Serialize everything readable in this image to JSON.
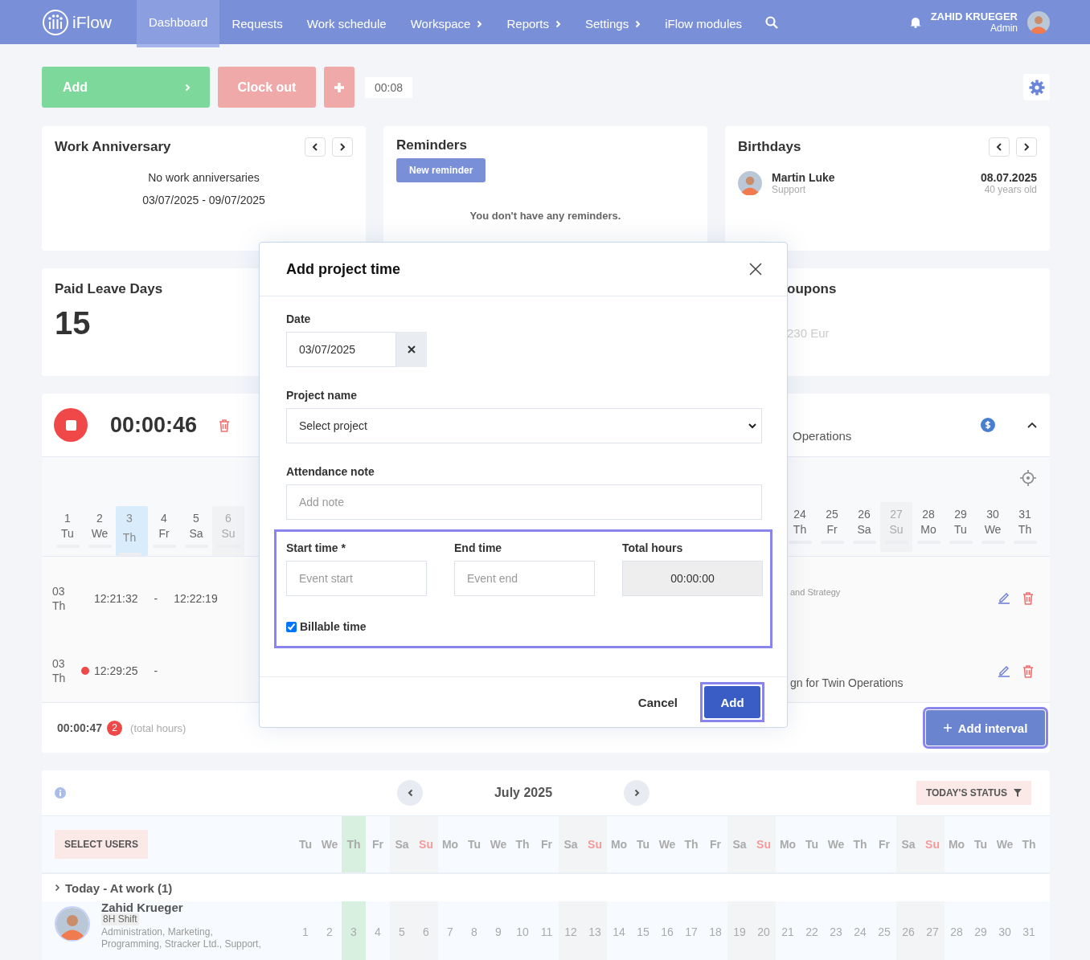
{
  "nav": {
    "logo": "iFlow",
    "items": [
      {
        "label": "Dashboard",
        "selected": true,
        "submenu": false
      },
      {
        "label": "Requests",
        "selected": false,
        "submenu": false
      },
      {
        "label": "Work schedule",
        "selected": false,
        "submenu": false
      },
      {
        "label": "Workspace",
        "selected": false,
        "submenu": true
      },
      {
        "label": "Reports",
        "selected": false,
        "submenu": true
      },
      {
        "label": "Settings",
        "selected": false,
        "submenu": true
      },
      {
        "label": "iFlow modules",
        "selected": false,
        "submenu": false
      }
    ],
    "user": {
      "name": "ZAHID KRUEGER",
      "role": "Admin"
    }
  },
  "toolbar": {
    "add_button": "Add",
    "clock_out_button": "Clock out",
    "elapsed": "00:08"
  },
  "work_anniversary": {
    "title": "Work Anniversary",
    "message": "No work anniversaries",
    "range": "03/07/2025 - 09/07/2025"
  },
  "reminders": {
    "title": "Reminders",
    "button": "New reminder",
    "empty": "You don't have any reminders."
  },
  "birthdays": {
    "title": "Birthdays",
    "person": {
      "name": "Martin Luke",
      "role": "Support",
      "date": "08.07.2025",
      "age": "40 years old"
    }
  },
  "paid_leave": {
    "title": "Paid Leave Days",
    "value": "15"
  },
  "coupons": {
    "title": "oupons",
    "amount": "230 Eur"
  },
  "timer": {
    "elapsed": "00:00:46",
    "project": "Operations",
    "days_start": [
      {
        "day": "1",
        "weekday": "Tu",
        "selected": false,
        "off": false
      },
      {
        "day": "2",
        "weekday": "We",
        "selected": false,
        "off": false
      },
      {
        "day": "3",
        "weekday": "Th",
        "selected": true,
        "off": false
      },
      {
        "day": "4",
        "weekday": "Fr",
        "selected": false,
        "off": false
      },
      {
        "day": "5",
        "weekday": "Sa",
        "selected": false,
        "off": false
      },
      {
        "day": "6",
        "weekday": "Su",
        "selected": false,
        "off": true
      }
    ],
    "days_end": [
      {
        "day": "24",
        "weekday": "Th",
        "selected": false,
        "off": false
      },
      {
        "day": "25",
        "weekday": "Fr",
        "selected": false,
        "off": false
      },
      {
        "day": "26",
        "weekday": "Sa",
        "selected": false,
        "off": false
      },
      {
        "day": "27",
        "weekday": "Su",
        "selected": false,
        "off": true
      },
      {
        "day": "28",
        "weekday": "Mo",
        "selected": false,
        "off": false
      },
      {
        "day": "29",
        "weekday": "Tu",
        "selected": false,
        "off": false
      },
      {
        "day": "30",
        "weekday": "We",
        "selected": false,
        "off": false
      },
      {
        "day": "31",
        "weekday": "Th",
        "selected": false,
        "off": false
      }
    ],
    "entries": [
      {
        "date": "03",
        "weekday": "Th",
        "start": "12:21:32",
        "separator": "-",
        "end": "12:22:19",
        "running": false,
        "note": "and Strategy"
      },
      {
        "date": "03",
        "weekday": "Th",
        "start": "12:29:25",
        "separator": "-",
        "running": true,
        "task": "gn for Twin Operations"
      }
    ],
    "total": "00:00:47",
    "count": "2",
    "total_label": "(total hours)",
    "add_interval_button": "Add interval"
  },
  "modal": {
    "title": "Add project time",
    "date": {
      "label": "Date",
      "value": "03/07/2025"
    },
    "project": {
      "label": "Project name",
      "value": "Select project"
    },
    "note": {
      "label": "Attendance note",
      "placeholder": "Add note"
    },
    "start": {
      "label": "Start time *",
      "placeholder": "Event start"
    },
    "end": {
      "label": "End time",
      "placeholder": "Event end"
    },
    "total": {
      "label": "Total hours",
      "value": "00:00:00"
    },
    "billable": {
      "label": "Billable time",
      "checked": true
    },
    "cancel": "Cancel",
    "submit": "Add"
  },
  "calendar": {
    "month": "July 2025",
    "status_button": "TODAY'S STATUS",
    "select_users_button": "SELECT USERS",
    "days": [
      {
        "day": "1",
        "weekday": "Tu",
        "kind": "weekday",
        "today": false
      },
      {
        "day": "2",
        "weekday": "We",
        "kind": "weekday",
        "today": false
      },
      {
        "day": "3",
        "weekday": "Th",
        "kind": "weekday",
        "today": true
      },
      {
        "day": "4",
        "weekday": "Fr",
        "kind": "weekday",
        "today": false
      },
      {
        "day": "5",
        "weekday": "Sa",
        "kind": "saturday",
        "today": false
      },
      {
        "day": "6",
        "weekday": "Su",
        "kind": "sunday",
        "today": false
      },
      {
        "day": "7",
        "weekday": "Mo",
        "kind": "weekday",
        "today": false
      },
      {
        "day": "8",
        "weekday": "Tu",
        "kind": "weekday",
        "today": false
      },
      {
        "day": "9",
        "weekday": "We",
        "kind": "weekday",
        "today": false
      },
      {
        "day": "10",
        "weekday": "Th",
        "kind": "weekday",
        "today": false
      },
      {
        "day": "11",
        "weekday": "Fr",
        "kind": "weekday",
        "today": false
      },
      {
        "day": "12",
        "weekday": "Sa",
        "kind": "saturday",
        "today": false
      },
      {
        "day": "13",
        "weekday": "Su",
        "kind": "sunday",
        "today": false
      },
      {
        "day": "14",
        "weekday": "Mo",
        "kind": "weekday",
        "today": false
      },
      {
        "day": "15",
        "weekday": "Tu",
        "kind": "weekday",
        "today": false
      },
      {
        "day": "16",
        "weekday": "We",
        "kind": "weekday",
        "today": false
      },
      {
        "day": "17",
        "weekday": "Th",
        "kind": "weekday",
        "today": false
      },
      {
        "day": "18",
        "weekday": "Fr",
        "kind": "weekday",
        "today": false
      },
      {
        "day": "19",
        "weekday": "Sa",
        "kind": "saturday",
        "today": false
      },
      {
        "day": "20",
        "weekday": "Su",
        "kind": "sunday",
        "today": false
      },
      {
        "day": "21",
        "weekday": "Mo",
        "kind": "weekday",
        "today": false
      },
      {
        "day": "22",
        "weekday": "Tu",
        "kind": "weekday",
        "today": false
      },
      {
        "day": "23",
        "weekday": "We",
        "kind": "weekday",
        "today": false
      },
      {
        "day": "24",
        "weekday": "Th",
        "kind": "weekday",
        "today": false
      },
      {
        "day": "25",
        "weekday": "Fr",
        "kind": "weekday",
        "today": false
      },
      {
        "day": "26",
        "weekday": "Sa",
        "kind": "saturday",
        "today": false
      },
      {
        "day": "27",
        "weekday": "Su",
        "kind": "sunday",
        "today": false
      },
      {
        "day": "28",
        "weekday": "Mo",
        "kind": "weekday",
        "today": false
      },
      {
        "day": "29",
        "weekday": "Tu",
        "kind": "weekday",
        "today": false
      },
      {
        "day": "30",
        "weekday": "We",
        "kind": "weekday",
        "today": false
      },
      {
        "day": "31",
        "weekday": "Th",
        "kind": "weekday",
        "today": false
      }
    ],
    "group": "Today - At work (1)",
    "users": [
      {
        "name": "Zahid Krueger",
        "shift": "8H Shift",
        "departments": "Administration, Marketing, Programming, Stracker Ltd., Support,"
      }
    ]
  }
}
